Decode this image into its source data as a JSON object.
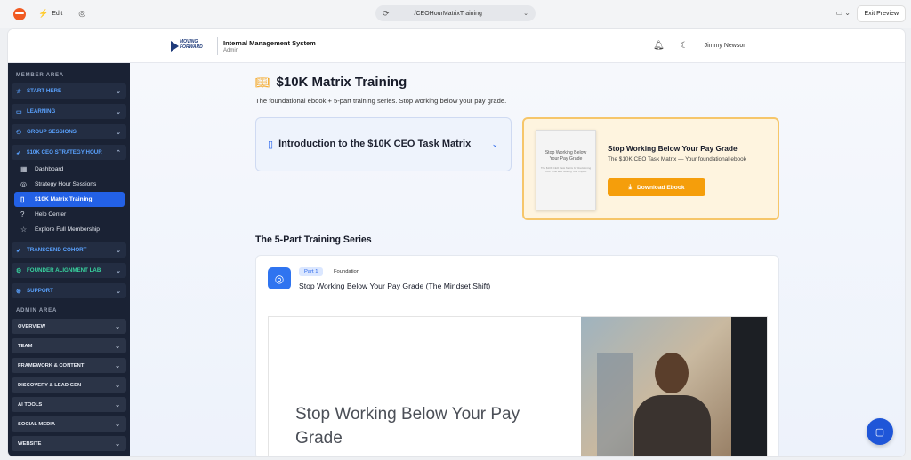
{
  "browser": {
    "edit_label": "Edit",
    "url": "/CEOHourMatrixTraining",
    "exit_preview_label": "Exit Preview"
  },
  "header": {
    "brand_line1": "MOVING",
    "brand_line2": "FORWARD",
    "title": "Internal Management System",
    "subtitle": "Admin",
    "user_name": "Jimmy Newson"
  },
  "sidebar": {
    "member_title": "MEMBER AREA",
    "start_here": "START HERE",
    "learning": "LEARNING",
    "group_sessions": "GROUP SESSIONS",
    "strategy_hour": "$10K CEO STRATEGY HOUR",
    "sub_items": [
      {
        "label": "Dashboard"
      },
      {
        "label": "Strategy Hour Sessions"
      },
      {
        "label": "$10K Matrix Training"
      },
      {
        "label": "Help Center"
      },
      {
        "label": "Explore Full Membership"
      }
    ],
    "transcend": "TRANSCEND COHORT",
    "founder_lab": "FOUNDER ALIGNMENT LAB",
    "support": "SUPPORT",
    "admin_title": "ADMIN AREA",
    "admin_items": [
      {
        "label": "OVERVIEW"
      },
      {
        "label": "TEAM"
      },
      {
        "label": "FRAMEWORK & CONTENT"
      },
      {
        "label": "DISCOVERY & LEAD GEN"
      },
      {
        "label": "AI TOOLS"
      },
      {
        "label": "SOCIAL MEDIA"
      },
      {
        "label": "WEBSITE"
      }
    ]
  },
  "main": {
    "title": "$10K Matrix Training",
    "subtitle": "The foundational ebook + 5-part training series. Stop working below your pay grade.",
    "intro_card_title": "Introduction to the $10K CEO Task Matrix",
    "ebook": {
      "cover_title": "Stop Working Below Your Pay Grade",
      "cover_sub": "The $10K CEO Task Matrix for Reclaiming Your Time and Scaling Your Impact",
      "title": "Stop Working Below Your Pay Grade",
      "subtitle": "The $10K CEO Task Matrix — Your foundational ebook",
      "button": "Download Ebook"
    },
    "series_heading": "The 5-Part Training Series",
    "part": {
      "badge": "Part 1",
      "category": "Foundation",
      "title": "Stop Working Below Your Pay Grade (The Mindset Shift)",
      "hero_text": "Stop Working Below Your Pay Grade"
    }
  },
  "colors": {
    "sidebar_bg": "#1a2234",
    "accent_blue": "#2563eb",
    "accent_orange": "#f59e0b",
    "nav_blue": "#5aa2ff",
    "nav_green": "#38d39f"
  }
}
